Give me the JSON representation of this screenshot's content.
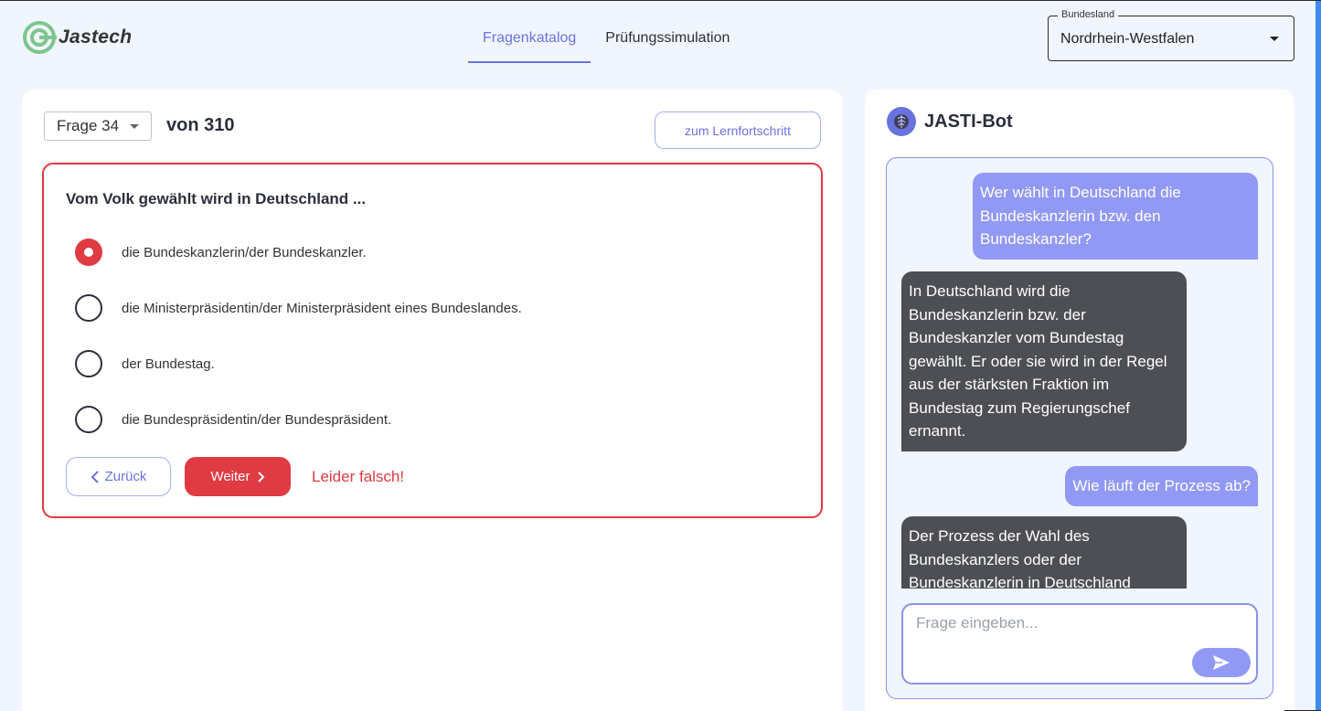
{
  "brand": {
    "name": "Jastech",
    "logo_icon": "jastech-logo-icon",
    "colors": {
      "accent": "#6a72e0",
      "error": "#e03a42",
      "logo_green": "#7dc48d"
    }
  },
  "nav": {
    "tabs": [
      {
        "label": "Fragenkatalog",
        "active": true
      },
      {
        "label": "Prüfungssimulation",
        "active": false
      }
    ]
  },
  "state_select": {
    "legend": "Bundesland",
    "value": "Nordrhein-Westfalen"
  },
  "quiz": {
    "question_select": "Frage 34",
    "total": "von 310",
    "progress_button": "zum Lernfortschritt",
    "question": "Vom Volk gewählt wird in Deutschland ...",
    "answers": [
      {
        "label": "die Bundeskanzlerin/der Bundeskanzler.",
        "selected": true
      },
      {
        "label": "die Ministerpräsidentin/der Ministerpräsident eines Bundeslandes.",
        "selected": false
      },
      {
        "label": "der Bundestag.",
        "selected": false
      },
      {
        "label": "die Bundespräsidentin/der Bundespräsident.",
        "selected": false
      }
    ],
    "back_label": "Zurück",
    "next_label": "Weiter",
    "feedback": "Leider falsch!"
  },
  "bot": {
    "title": "JASTI-Bot",
    "messages": [
      {
        "role": "user",
        "text": "Wer wählt in Deutschland die Bundeskanzlerin bzw. den Bundeskanzler?"
      },
      {
        "role": "bot",
        "text": "In Deutschland wird die Bundeskanzlerin bzw. der Bundeskanzler vom Bundestag gewählt. Er oder sie wird in der Regel aus der stärksten Fraktion im Bundestag zum Regierungschef ernannt."
      },
      {
        "role": "user",
        "text": "Wie läuft der Prozess ab?"
      },
      {
        "role": "bot",
        "text": "Der Prozess der Wahl des Bundeskanzlers oder der Bundeskanzlerin in Deutschland"
      }
    ],
    "input_placeholder": "Frage eingeben..."
  }
}
